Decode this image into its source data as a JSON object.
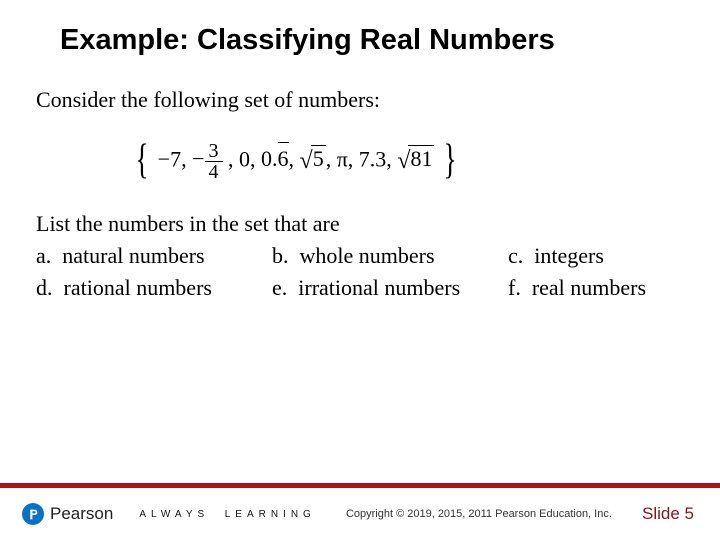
{
  "title": "Example: Classifying Real Numbers",
  "intro": "Consider the following set of numbers:",
  "set": {
    "items": [
      "−7,",
      "−",
      "3",
      "4",
      ", 0,",
      "0.",
      "6",
      ",",
      "5",
      ", π, 7.3,",
      "81"
    ]
  },
  "listHeader": "List the numbers in the set that are",
  "options": {
    "a": "a.  natural numbers",
    "b": "b.  whole numbers",
    "c": "c.  integers",
    "d": "d.  rational numbers",
    "e": "e.  irrational numbers",
    "f": "f.  real numbers"
  },
  "footer": {
    "brand": "Pearson",
    "tagline": "ALWAYS  LEARNING",
    "copyright": "Copyright © 2019, 2015, 2011 Pearson Education, Inc.",
    "slide": "Slide 5"
  }
}
